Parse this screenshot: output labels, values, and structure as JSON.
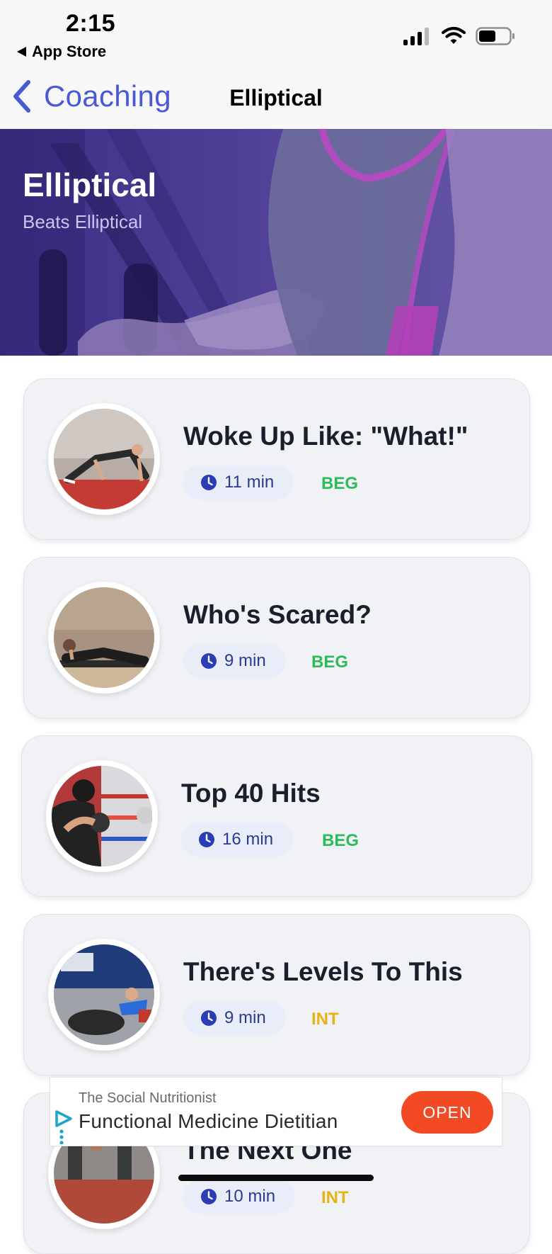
{
  "status_bar": {
    "time": "2:15",
    "back_app": "App Store",
    "icons": [
      "signal-icon",
      "wifi-icon",
      "battery-icon"
    ]
  },
  "nav": {
    "back_label": "Coaching",
    "title": "Elliptical"
  },
  "hero": {
    "title": "Elliptical",
    "subtitle": "Beats Elliptical"
  },
  "workouts": [
    {
      "title": "Woke Up Like: \"What!\"",
      "duration": "11 min",
      "level": "BEG"
    },
    {
      "title": "Who's Scared?",
      "duration": "9 min",
      "level": "BEG"
    },
    {
      "title": "Top 40 Hits",
      "duration": "16 min",
      "level": "BEG"
    },
    {
      "title": "There's Levels To This",
      "duration": "9 min",
      "level": "INT"
    },
    {
      "title": "The Next One",
      "duration": "10 min",
      "level": "INT"
    }
  ],
  "ad": {
    "advertiser": "The Social Nutritionist",
    "headline": "Functional Medicine Dietitian",
    "cta": "OPEN"
  },
  "colors": {
    "accent": "#4a5ad2",
    "beginner": "#2dbc5a",
    "intermediate": "#e5b313",
    "ad_cta": "#f34a26"
  }
}
